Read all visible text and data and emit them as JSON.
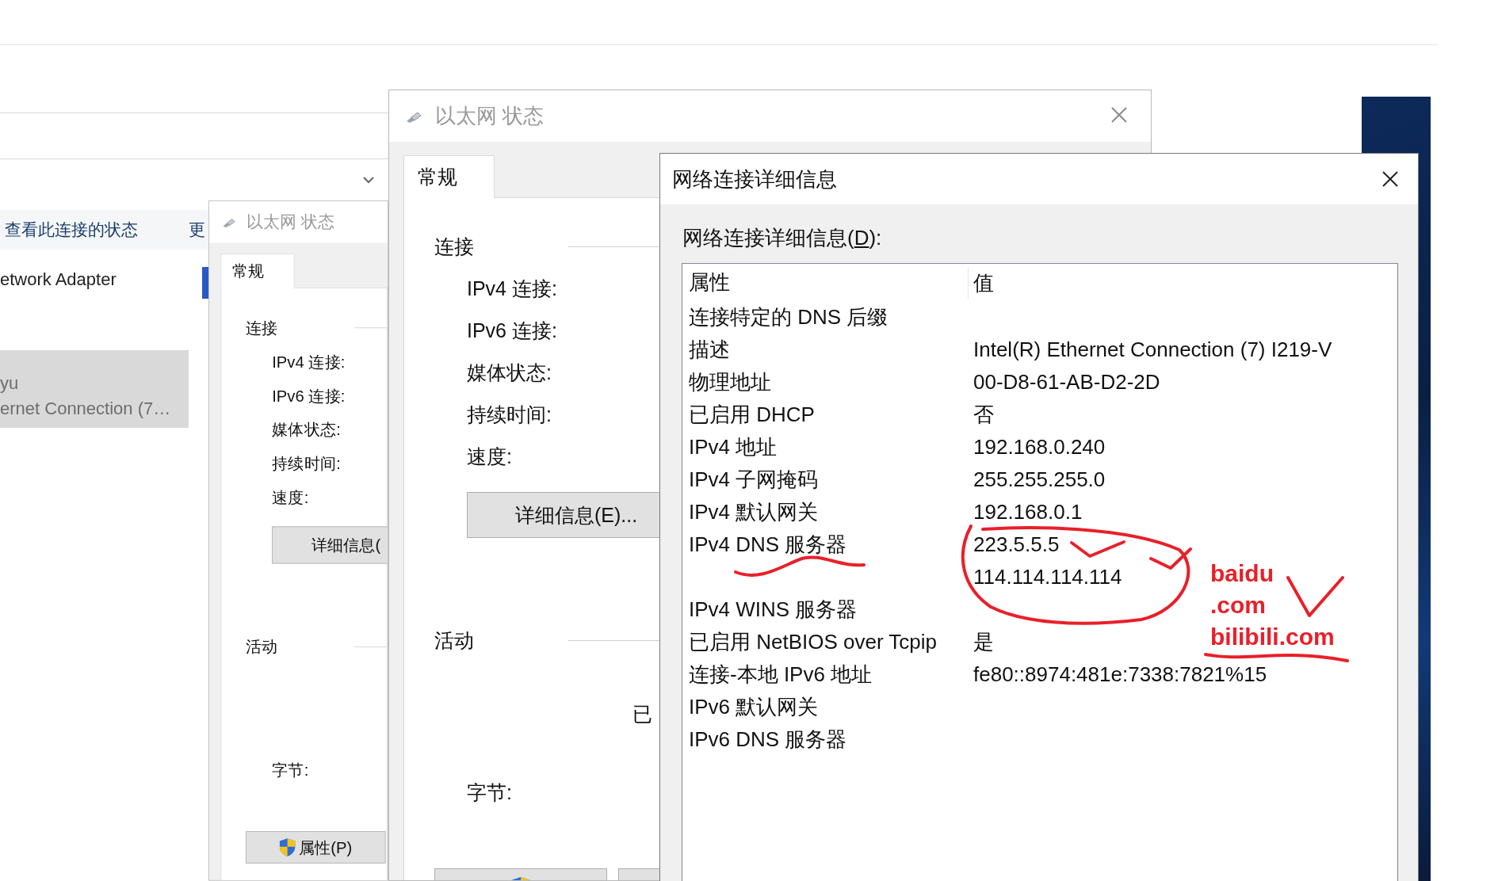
{
  "explorer": {
    "toolbar": [
      {
        "label": "查看此连接的状态"
      },
      {
        "label": "更"
      }
    ],
    "adapters": [
      {
        "lines": [
          "etwork Adapter"
        ],
        "selected": false
      },
      {
        "lines": [
          "yu",
          "ernet Connection (7…"
        ],
        "selected": true
      }
    ]
  },
  "status_windows": [
    {
      "title": "以太网 状态",
      "closable": false,
      "tab": {
        "label": "常规",
        "selected": true
      },
      "connection_heading": "连接",
      "fields": [
        "IPv4 连接:",
        "IPv6 连接:",
        "媒体状态:",
        "持续时间:",
        "速度:"
      ],
      "details_button": "详细信息(",
      "activity_heading": "活动",
      "bytes_label": "字节:",
      "bottom_buttons": [
        {
          "label": "属性(P)",
          "shield": true
        }
      ]
    },
    {
      "title": "以太网 状态",
      "closable": true,
      "tab": {
        "label": "常规",
        "selected": true
      },
      "connection_heading": "连接",
      "fields": [
        "IPv4 连接:",
        "IPv6 连接:",
        "媒体状态:",
        "持续时间:",
        "速度:"
      ],
      "details_button": "详细信息(E)...",
      "activity_heading": "活动",
      "activity_fragment": "已",
      "bytes_label": "字节:",
      "bottom_buttons": [
        {
          "shield": true
        },
        {
          "shield": false
        }
      ]
    }
  ],
  "details_window": {
    "title": "网络连接详细信息",
    "closable": true,
    "list_label": {
      "before": "网络连接详细信息(",
      "access_key": "D",
      "after": "):"
    },
    "columns": [
      "属性",
      "值"
    ],
    "rows": [
      {
        "property": "连接特定的 DNS 后缀"
      },
      {
        "property": "描述",
        "values": [
          "Intel(R) Ethernet Connection (7) I219-V"
        ]
      },
      {
        "property": "物理地址",
        "values": [
          "00-D8-61-AB-D2-2D"
        ]
      },
      {
        "property": "已启用 DHCP",
        "values": [
          "否"
        ]
      },
      {
        "property": "IPv4 地址",
        "values": [
          "192.168.0.240"
        ]
      },
      {
        "property": "IPv4 子网掩码",
        "values": [
          "255.255.255.0"
        ]
      },
      {
        "property": "IPv4 默认网关",
        "values": [
          "192.168.0.1"
        ]
      },
      {
        "property": "IPv4 DNS 服务器",
        "values": [
          "223.5.5.5",
          "114.114.114.114"
        ]
      },
      {
        "property": "IPv4 WINS 服务器"
      },
      {
        "property": "已启用 NetBIOS over Tcpip",
        "values": [
          "是"
        ]
      },
      {
        "property": "连接-本地 IPv6 地址",
        "values": [
          "fe80::8974:481e:7338:7821%15"
        ]
      },
      {
        "property": "IPv6 默认网关"
      },
      {
        "property": "IPv6 DNS 服务器"
      }
    ]
  },
  "annotations": {
    "notes": [
      "baidu",
      ".com",
      "bilibili.com"
    ]
  }
}
